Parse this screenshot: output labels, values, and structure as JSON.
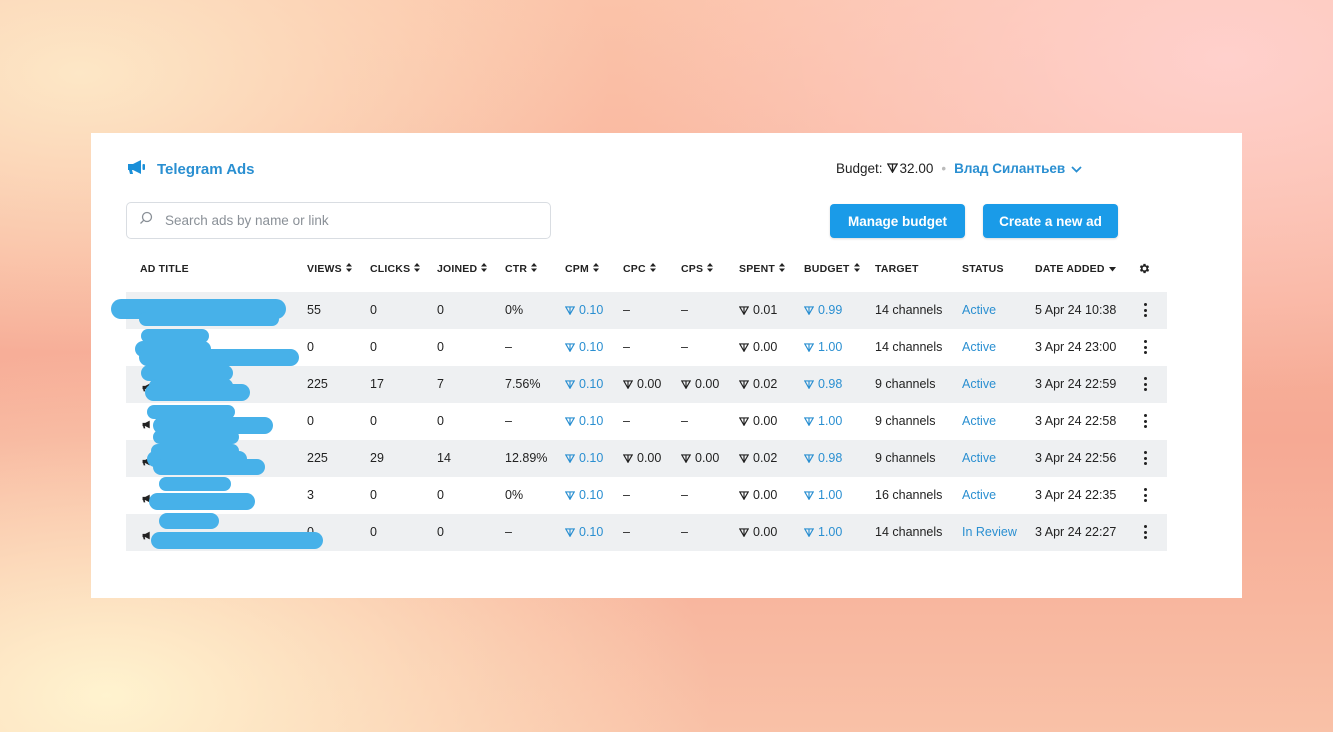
{
  "header": {
    "brand": "Telegram Ads",
    "budget_label": "Budget:",
    "budget_value": "32.00",
    "user_name": "Влад Силантьев"
  },
  "search": {
    "placeholder": "Search ads by name or link"
  },
  "buttons": {
    "manage_budget": "Manage budget",
    "create_ad": "Create a new ad"
  },
  "columns": [
    "AD TITLE",
    "VIEWS",
    "CLICKS",
    "JOINED",
    "CTR",
    "CPM",
    "CPC",
    "CPS",
    "SPENT",
    "BUDGET",
    "TARGET",
    "STATUS",
    "DATE ADDED"
  ],
  "rows": [
    {
      "views": "55",
      "clicks": "0",
      "joined": "0",
      "ctr": "0%",
      "cpm": "0.10",
      "cpc": "–",
      "cps": "–",
      "spent": "0.01",
      "budget": "0.99",
      "target": "14 channels",
      "status": "Active",
      "date": "5 Apr 24 10:38"
    },
    {
      "views": "0",
      "clicks": "0",
      "joined": "0",
      "ctr": "–",
      "cpm": "0.10",
      "cpc": "–",
      "cps": "–",
      "spent": "0.00",
      "budget": "1.00",
      "target": "14 channels",
      "status": "Active",
      "date": "3 Apr 24 23:00"
    },
    {
      "views": "225",
      "clicks": "17",
      "joined": "7",
      "ctr": "7.56%",
      "cpm": "0.10",
      "cpc": "0.00",
      "cps": "0.00",
      "spent": "0.02",
      "budget": "0.98",
      "target": "9 channels",
      "status": "Active",
      "date": "3 Apr 24 22:59"
    },
    {
      "views": "0",
      "clicks": "0",
      "joined": "0",
      "ctr": "–",
      "cpm": "0.10",
      "cpc": "–",
      "cps": "–",
      "spent": "0.00",
      "budget": "1.00",
      "target": "9 channels",
      "status": "Active",
      "date": "3 Apr 24 22:58"
    },
    {
      "views": "225",
      "clicks": "29",
      "joined": "14",
      "ctr": "12.89%",
      "cpm": "0.10",
      "cpc": "0.00",
      "cps": "0.00",
      "spent": "0.02",
      "budget": "0.98",
      "target": "9 channels",
      "status": "Active",
      "date": "3 Apr 24 22:56"
    },
    {
      "views": "3",
      "clicks": "0",
      "joined": "0",
      "ctr": "0%",
      "cpm": "0.10",
      "cpc": "–",
      "cps": "–",
      "spent": "0.00",
      "budget": "1.00",
      "target": "16 channels",
      "status": "Active",
      "date": "3 Apr 24 22:35"
    },
    {
      "views": "0",
      "clicks": "0",
      "joined": "0",
      "ctr": "–",
      "cpm": "0.10",
      "cpc": "–",
      "cps": "–",
      "spent": "0.00",
      "budget": "1.00",
      "target": "14 channels",
      "status": "In Review",
      "date": "3 Apr 24 22:27"
    }
  ],
  "icons": {
    "brand": "megaphone-icon",
    "search": "search-icon",
    "currency": "ton-icon",
    "sort": "sort-icon",
    "settings": "gear-icon",
    "row_menu": "more-vertical-icon"
  },
  "colors": {
    "accent": "#1a9be8",
    "link": "#2a8fd1",
    "redaction": "#47b1e9",
    "row_alt": "#eef0f2"
  }
}
